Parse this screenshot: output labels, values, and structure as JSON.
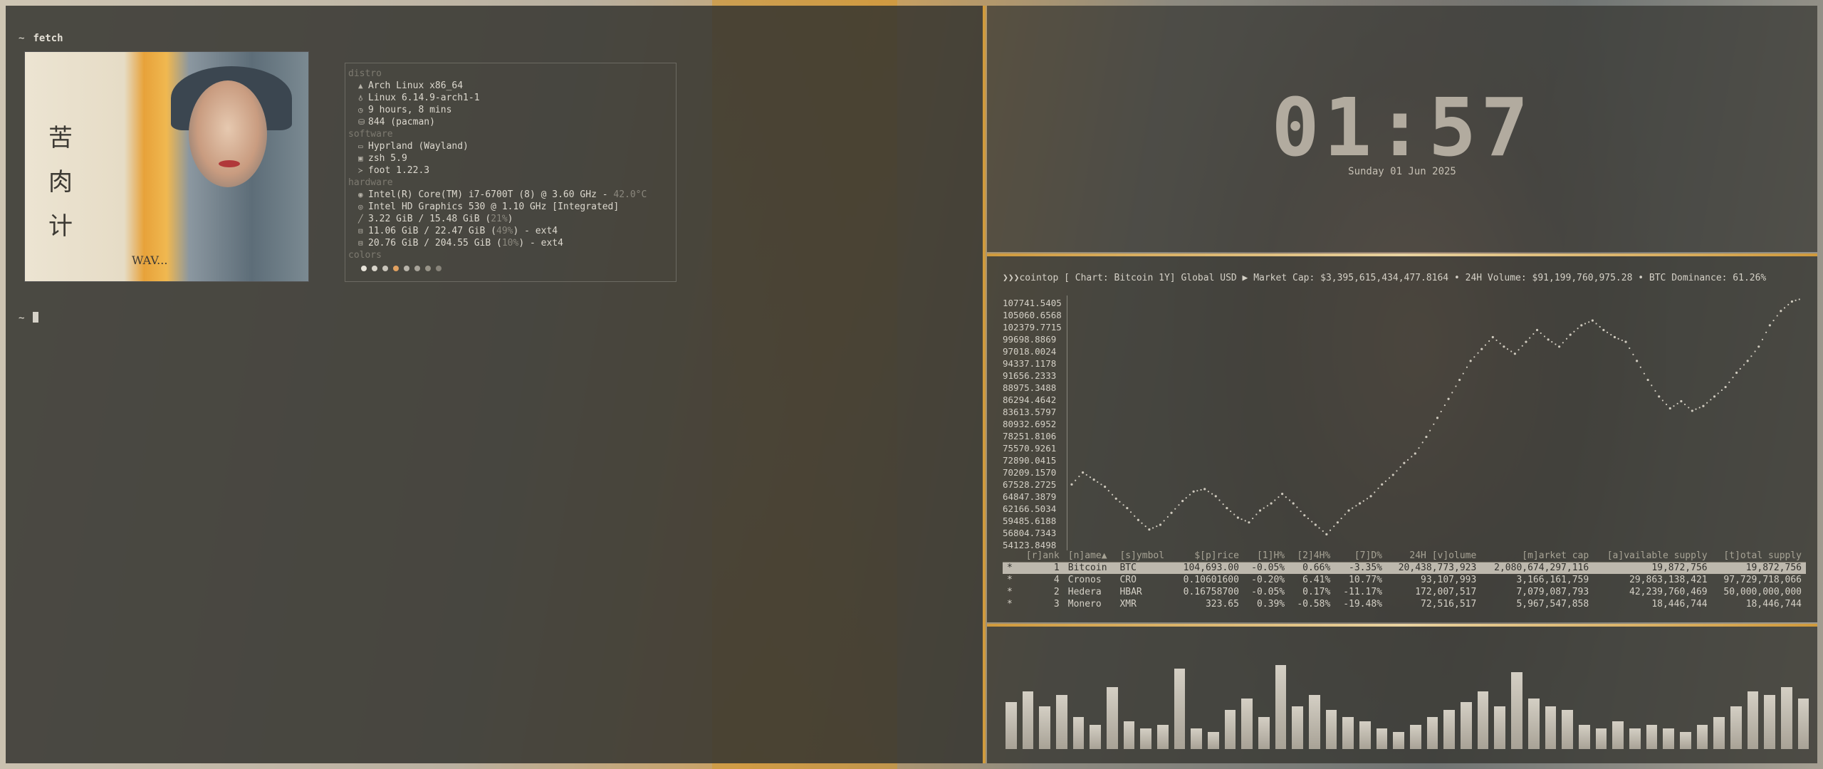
{
  "terminal": {
    "prompt_symbol": "~",
    "command": "fetch",
    "second_prompt_symbol": "~"
  },
  "fetch_image": {
    "glyphs": [
      "苦",
      "肉",
      "计"
    ],
    "signature": "WAV..."
  },
  "fetch": {
    "sections": {
      "distro": "distro",
      "software": "software",
      "hardware": "hardware",
      "colors": "colors"
    },
    "distro": [
      {
        "icon": "arch-icon",
        "value": "Arch Linux x86_64"
      },
      {
        "icon": "linux-icon",
        "value": "Linux 6.14.9-arch1-1"
      },
      {
        "icon": "clock-icon",
        "value": "9 hours, 8 mins"
      },
      {
        "icon": "package-icon",
        "value": "844 (pacman)"
      }
    ],
    "software": [
      {
        "icon": "window-icon",
        "value": "Hyprland (Wayland)"
      },
      {
        "icon": "shell-icon",
        "value": "zsh 5.9"
      },
      {
        "icon": "terminal-icon",
        "value": "foot 1.22.3"
      }
    ],
    "hardware": {
      "cpu": {
        "value": "Intel(R) Core(TM) i7-6700T (8) @ 3.60 GHz - ",
        "temp": "42.0°C"
      },
      "gpu": "Intel HD Graphics 530 @ 1.10 GHz [Integrated]",
      "memory": {
        "a": "3.22 GiB / 15.48 GiB (",
        "pct": "21%",
        "b": ")"
      },
      "disk1": {
        "a": "11.06 GiB / 22.47 GiB (",
        "pct": "49%",
        "b": ") - ext4"
      },
      "disk2": {
        "a": "20.76 GiB / 204.55 GiB (",
        "pct": "10%",
        "b": ") - ext4"
      }
    },
    "color_dots": [
      "#e8e4da",
      "#d8d4ca",
      "#c8c4ba",
      "#e0a060",
      "#b8b4aa",
      "#a8a49a",
      "#989488",
      "#88847a"
    ]
  },
  "clock": {
    "time": "01:57",
    "date": "Sunday 01 Jun 2025"
  },
  "cointop": {
    "header": "❯❯❯cointop [ Chart: Bitcoin 1Y] Global USD ▶ Market Cap: $3,395,615,434,477.8164 • 24H Volume: $91,199,760,975.28 • BTC Dominance: 61.26%",
    "y_labels": [
      "107741.5405",
      "105060.6568",
      "102379.7715",
      "99698.8869",
      "97018.0024",
      "94337.1178",
      "91656.2333",
      "88975.3488",
      "86294.4642",
      "83613.5797",
      "80932.6952",
      "78251.8106",
      "75570.9261",
      "72890.0415",
      "70209.1570",
      "67528.2725",
      "64847.3879",
      "62166.5034",
      "59485.6188",
      "56804.7343",
      "54123.8498"
    ],
    "columns": [
      "[r]ank",
      "[n]ame▲",
      "[s]ymbol",
      "$[p]rice",
      "[1]H%",
      "[2]4H%",
      "[7]D%",
      "24H [v]olume",
      "[m]arket cap",
      "[a]vailable supply",
      "[t]otal supply"
    ],
    "rows": [
      {
        "star": "*",
        "rank": "1",
        "name": "Bitcoin",
        "symbol": "BTC",
        "price": "104,693.00",
        "h1": "-0.05%",
        "h24": "0.66%",
        "d7": "-3.35%",
        "vol": "20,438,773,923",
        "mcap": "2,080,674,297,116",
        "avail": "19,872,756",
        "total": "19,872,756",
        "selected": true
      },
      {
        "star": "*",
        "rank": "4",
        "name": "Cronos",
        "symbol": "CRO",
        "price": "0.10601600",
        "h1": "-0.20%",
        "h24": "6.41%",
        "d7": "10.77%",
        "vol": "93,107,993",
        "mcap": "3,166,161,759",
        "avail": "29,863,138,421",
        "total": "97,729,718,066",
        "selected": false
      },
      {
        "star": "*",
        "rank": "2",
        "name": "Hedera",
        "symbol": "HBAR",
        "price": "0.16758700",
        "h1": "-0.05%",
        "h24": "0.17%",
        "d7": "-11.17%",
        "vol": "172,007,517",
        "mcap": "7,079,087,793",
        "avail": "42,239,760,469",
        "total": "50,000,000,000",
        "selected": false
      },
      {
        "star": "*",
        "rank": "3",
        "name": "Monero",
        "symbol": "XMR",
        "price": "323.65",
        "h1": "0.39%",
        "h24": "-0.58%",
        "d7": "-19.48%",
        "vol": "72,516,517",
        "mcap": "5,967,547,858",
        "avail": "18,446,744",
        "total": "18,446,744",
        "selected": false
      }
    ]
  },
  "chart_data": {
    "type": "scatter",
    "title": "",
    "xlabel": "",
    "ylabel": "",
    "ylim": [
      54123.8498,
      107741.5405
    ],
    "y": [
      68000,
      70500,
      69000,
      67500,
      65000,
      63000,
      60500,
      58500,
      59500,
      62000,
      64500,
      66500,
      67000,
      65500,
      63000,
      61000,
      60000,
      62500,
      64000,
      66000,
      64000,
      61500,
      59500,
      57500,
      60000,
      62500,
      64000,
      65500,
      68000,
      70000,
      72500,
      74500,
      78000,
      82000,
      86000,
      90000,
      94000,
      96500,
      99000,
      97000,
      95500,
      98000,
      100500,
      98500,
      97000,
      99500,
      101500,
      102500,
      100500,
      99000,
      98000,
      94000,
      90000,
      86500,
      84000,
      85500,
      83500,
      84500,
      86500,
      88500,
      91500,
      94000,
      97000,
      101500,
      104500,
      106500,
      107200
    ],
    "visualizer_bars": [
      22,
      28,
      20,
      26,
      14,
      10,
      30,
      12,
      8,
      10,
      40,
      8,
      6,
      18,
      24,
      14,
      42,
      20,
      26,
      18,
      14,
      12,
      8,
      6,
      10,
      14,
      18,
      22,
      28,
      20,
      38,
      24,
      20,
      18,
      10,
      8,
      12,
      8,
      10,
      8,
      6,
      10,
      14,
      20,
      28,
      26,
      30,
      24
    ]
  }
}
